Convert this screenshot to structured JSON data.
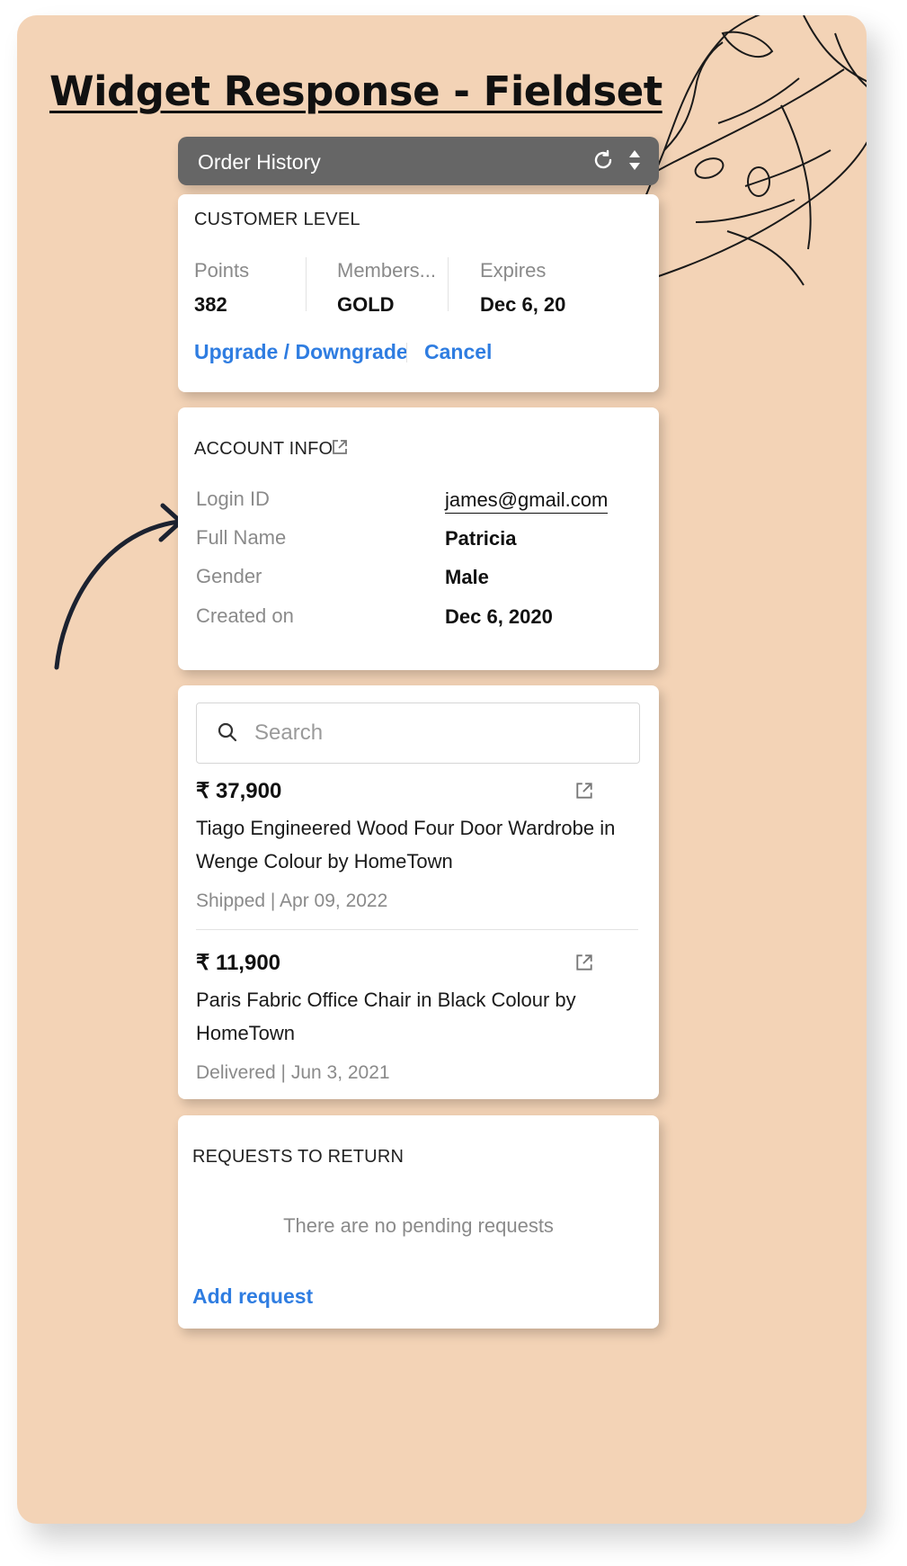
{
  "title": "Widget Response - Fieldset",
  "widget": {
    "header_title": "Order History",
    "customer_level": {
      "section_title": "CUSTOMER LEVEL",
      "columns": [
        {
          "label": "Points",
          "value": "382"
        },
        {
          "label": "Members...",
          "value": "GOLD"
        },
        {
          "label": "Expires",
          "value": "Dec 6, 20"
        }
      ],
      "upgrade_label": "Upgrade / Downgrade",
      "cancel_label": "Cancel"
    },
    "account_info": {
      "section_title": "ACCOUNT INFO",
      "rows": [
        {
          "label": "Login ID",
          "value": "james@gmail.com"
        },
        {
          "label": "Full Name",
          "value": "Patricia"
        },
        {
          "label": "Gender",
          "value": "Male"
        },
        {
          "label": "Created on",
          "value": "Dec 6, 2020"
        }
      ]
    },
    "orders": {
      "search_placeholder": "Search",
      "items": [
        {
          "price": "₹ 37,900",
          "description": "Tiago Engineered Wood Four Door Wardrobe in Wenge Colour by HomeTown",
          "status": "Shipped | Apr 09, 2022"
        },
        {
          "price": "₹ 11,900",
          "description": "Paris Fabric Office Chair in Black Colour by HomeTown",
          "status": "Delivered | Jun 3, 2021"
        }
      ]
    },
    "returns": {
      "section_title": "REQUESTS TO RETURN",
      "empty_text": "There are no pending requests",
      "add_label": "Add request"
    }
  },
  "colors": {
    "panel": "#f3d3b6",
    "header": "#666666",
    "link": "#2f7de1"
  },
  "icons": [
    "refresh-icon",
    "sort-updown-icon",
    "external-link-icon",
    "search-icon",
    "leaf-illustration",
    "curved-arrow"
  ]
}
